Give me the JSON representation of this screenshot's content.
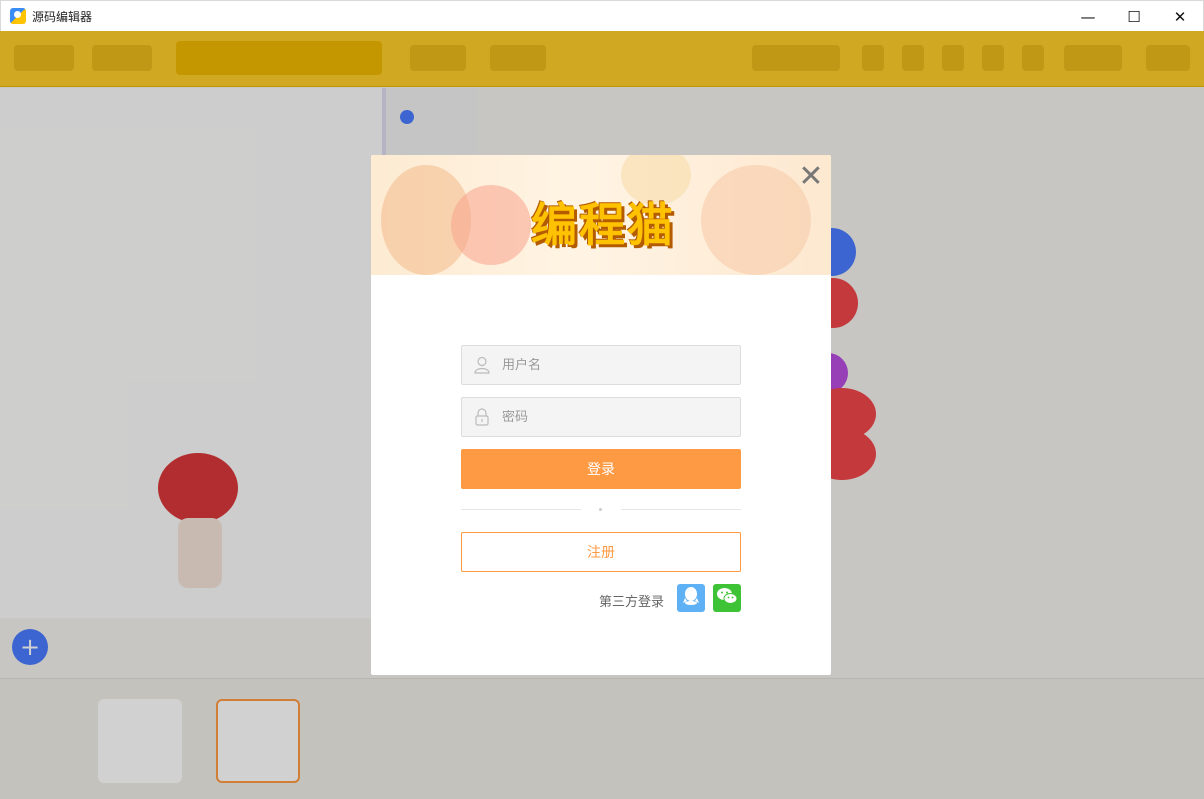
{
  "window": {
    "title": "源码编辑器",
    "controls": {
      "minimize": "—",
      "maximize": "☐",
      "close": "✕"
    }
  },
  "login_modal": {
    "logo_text": "编程猫",
    "close_symbol": "✕",
    "username_placeholder": "用户名",
    "password_placeholder": "密码",
    "login_label": "登录",
    "register_label": "注册",
    "third_party_label": "第三方登录",
    "third_party_providers": [
      "qq-icon",
      "wechat-icon"
    ]
  },
  "colors": {
    "primary": "#ff9a44",
    "toolbar": "#ffcd2a",
    "qq": "#5fb1f5",
    "wechat": "#3ec337"
  }
}
